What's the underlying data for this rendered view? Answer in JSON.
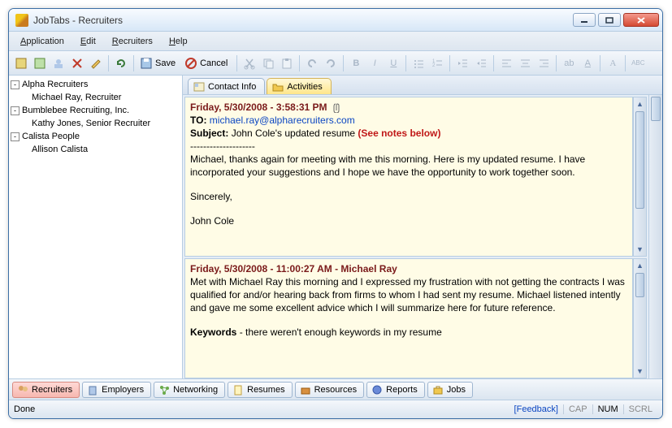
{
  "window": {
    "title": "JobTabs - Recruiters"
  },
  "menu": {
    "application": "Application",
    "edit": "Edit",
    "recruiters": "Recruiters",
    "help": "Help"
  },
  "toolbar": {
    "save": "Save",
    "cancel": "Cancel"
  },
  "tree": {
    "groups": [
      {
        "name": "Alpha Recruiters",
        "children": [
          "Michael Ray, Recruiter"
        ]
      },
      {
        "name": "Bumblebee Recruiting, Inc.",
        "children": [
          "Kathy Jones, Senior Recruiter"
        ]
      },
      {
        "name": "Calista People",
        "children": [
          "Allison Calista"
        ]
      }
    ]
  },
  "tabs": {
    "contact_info": "Contact Info",
    "activities": "Activities"
  },
  "notes": [
    {
      "date": "Friday, 5/30/2008 - 3:58:31 PM",
      "has_attachment": true,
      "to_label": "TO:",
      "to_email": "michael.ray@alpharecruiters.com",
      "subject_label": "Subject:",
      "subject_text": "John Cole's updated resume",
      "subject_red": "(See notes below)",
      "hr": "--------------------",
      "body": "Michael, thanks again for meeting with me this morning.  Here is my updated resume.  I have incorporated your suggestions and I hope we have the opportunity to work together soon.",
      "closing": "Sincerely,",
      "signature": "John Cole"
    },
    {
      "date": "Friday, 5/30/2008 - 11:00:27 AM - Michael Ray",
      "body": "Met with Michael Ray this morning and I expressed my frustration with not getting the contracts I was qualified for and/or hearing back from firms to whom I had sent my resume.  Michael listened intently and gave me some excellent advice which I will summarize here for future reference.",
      "kw_label": "Keywords",
      "kw_text": " - there weren't enough keywords in my resume"
    }
  ],
  "bottom_tabs": {
    "recruiters": "Recruiters",
    "employers": "Employers",
    "networking": "Networking",
    "resumes": "Resumes",
    "resources": "Resources",
    "reports": "Reports",
    "jobs": "Jobs"
  },
  "status": {
    "left": "Done",
    "feedback": "[Feedback]",
    "cap": "CAP",
    "num": "NUM",
    "scrl": "SCRL"
  }
}
